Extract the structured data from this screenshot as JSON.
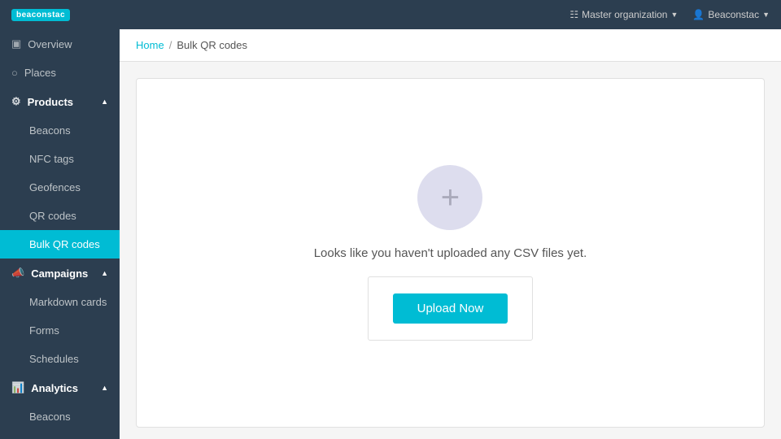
{
  "navbar": {
    "logo": "beaconstac",
    "org_label": "Master organization",
    "user_label": "Beaconstac"
  },
  "breadcrumb": {
    "home": "Home",
    "separator": "/",
    "current": "Bulk QR codes"
  },
  "sidebar": {
    "overview": "Overview",
    "places": "Places",
    "products_section": "Products",
    "beacons": "Beacons",
    "nfc_tags": "NFC tags",
    "geofences": "Geofences",
    "qr_codes": "QR codes",
    "bulk_qr_codes": "Bulk QR codes",
    "campaigns_section": "Campaigns",
    "markdown_cards": "Markdown cards",
    "forms": "Forms",
    "schedules": "Schedules",
    "analytics_section": "Analytics",
    "analytics_beacons": "Beacons"
  },
  "empty_state": {
    "message": "Looks like you haven't uploaded any CSV files yet.",
    "upload_button": "Upload Now",
    "icon": "+"
  }
}
